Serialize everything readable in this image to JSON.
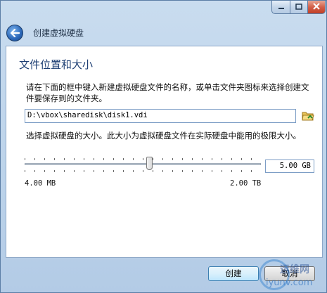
{
  "window": {
    "minimize_icon": "minimize-icon",
    "maximize_icon": "maximize-icon",
    "close_icon": "close-icon"
  },
  "wizard": {
    "title": "创建虚拟硬盘",
    "back_icon": "back-arrow-icon"
  },
  "page": {
    "heading": "文件位置和大小",
    "description": "请在下面的框中键入新建虚拟硬盘文件的名称，或单击文件夹图标来选择创建文件要保存到的文件夹。",
    "file_path": "D:\\vbox\\sharedisk\\disk1.vdi",
    "folder_icon": "folder-icon",
    "size_description": "选择虚拟硬盘的大小。此大小为虚拟硬盘文件在实际硬盘中能用的极限大小。",
    "size_value": "5.00 GB",
    "slider_fraction": 0.53,
    "range_min": "4.00 MB",
    "range_max": "2.00 TB"
  },
  "buttons": {
    "create": "创建",
    "cancel": "取消"
  },
  "watermark": {
    "cn": "运维网",
    "en": "iyunv.com"
  },
  "colors": {
    "accent": "#1d3e73",
    "titlebar": "#bcd3ea",
    "close": "#c23f27"
  }
}
